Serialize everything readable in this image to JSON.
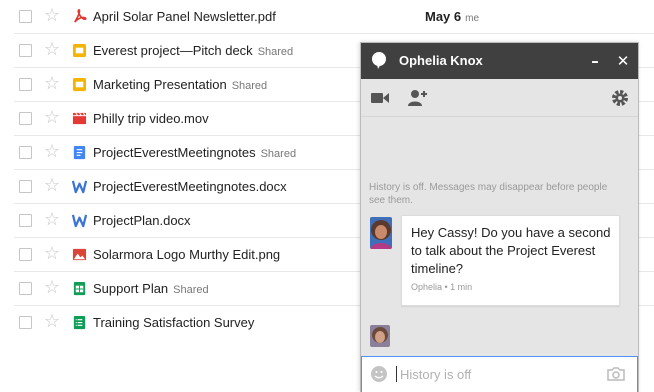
{
  "files": [
    {
      "name": "April Solar Panel Newsletter.pdf",
      "shared": "",
      "date": "May 6",
      "owner": "me",
      "icon": "pdf-icon"
    },
    {
      "name": "Everest project—Pitch deck",
      "shared": "Shared",
      "date": "",
      "owner": "",
      "icon": "slides-icon"
    },
    {
      "name": "Marketing Presentation",
      "shared": "Shared",
      "date": "",
      "owner": "",
      "icon": "slides-icon"
    },
    {
      "name": "Philly trip video.mov",
      "shared": "",
      "date": "",
      "owner": "",
      "icon": "video-icon"
    },
    {
      "name": "ProjectEverestMeetingnotes",
      "shared": "Shared",
      "date": "",
      "owner": "",
      "icon": "docs-icon"
    },
    {
      "name": "ProjectEverestMeetingnotes.docx",
      "shared": "",
      "date": "",
      "owner": "",
      "icon": "word-icon"
    },
    {
      "name": "ProjectPlan.docx",
      "shared": "",
      "date": "",
      "owner": "",
      "icon": "word-icon"
    },
    {
      "name": "Solarmora Logo Murthy Edit.png",
      "shared": "",
      "date": "",
      "owner": "",
      "icon": "image-icon"
    },
    {
      "name": "Support Plan",
      "shared": "Shared",
      "date": "",
      "owner": "",
      "icon": "sheets-icon"
    },
    {
      "name": "Training Satisfaction Survey",
      "shared": "",
      "date": "",
      "owner": "",
      "icon": "forms-icon"
    }
  ],
  "chat": {
    "contact_name": "Ophelia Knox",
    "minimize_glyph": "–",
    "close_glyph": "✕",
    "history_notice": "History is off. Messages may disappear before people see them.",
    "message": {
      "text": "Hey Cassy! Do you have a second to talk about the Project Everest timeline?",
      "meta": "Ophelia • 1 min"
    },
    "input_placeholder": "History is off",
    "icons": {
      "header": "chat-bubble-icon",
      "video": "video-call-icon",
      "add_person": "add-person-icon",
      "settings": "gear-icon",
      "emoji": "emoji-icon",
      "camera": "camera-icon"
    }
  },
  "colors": {
    "chat_header": "#404040",
    "chat_body": "#e5e5e5",
    "input_focus": "#4d90fe"
  }
}
